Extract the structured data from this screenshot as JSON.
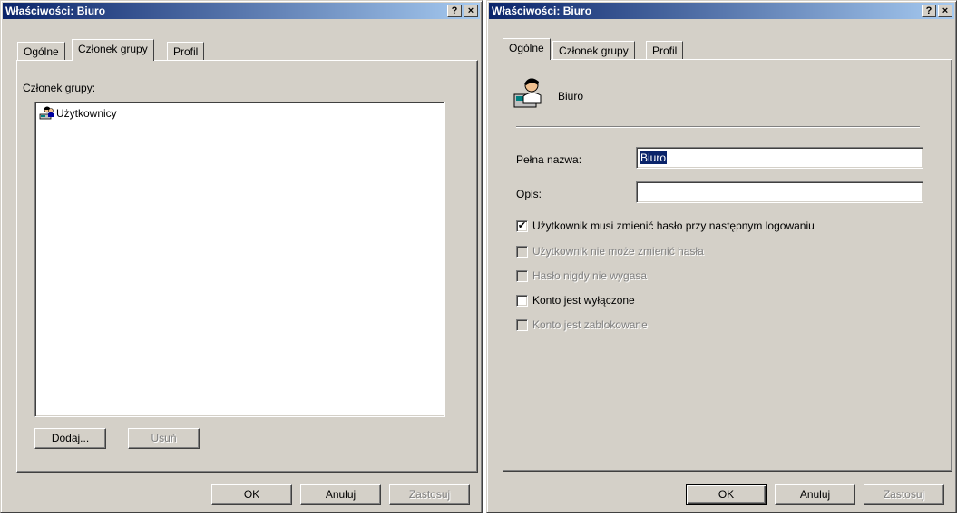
{
  "left_window": {
    "title": "Właściwości: Biuro",
    "help_button": "?",
    "close_button": "×",
    "tabs": [
      {
        "label": "Ogólne"
      },
      {
        "label": "Członek grupy"
      },
      {
        "label": "Profil"
      }
    ],
    "active_tab": "Członek grupy",
    "member_label": "Członek grupy:",
    "members": [
      {
        "name": "Użytkownicy",
        "icon": "group-icon"
      }
    ],
    "add_button": "Dodaj...",
    "remove_button": "Usuń",
    "ok_button": "OK",
    "cancel_button": "Anuluj",
    "apply_button": "Zastosuj"
  },
  "right_window": {
    "title": "Właściwości: Biuro",
    "help_button": "?",
    "close_button": "×",
    "tabs": [
      {
        "label": "Ogólne"
      },
      {
        "label": "Członek grupy"
      },
      {
        "label": "Profil"
      }
    ],
    "active_tab": "Ogólne",
    "user_icon": "user-icon",
    "user_name": "Biuro",
    "full_name_label": "Pełna nazwa:",
    "full_name_value": "Biuro",
    "description_label": "Opis:",
    "description_value": "",
    "checkboxes": [
      {
        "label": "Użytkownik musi zmienić hasło przy następnym logowaniu",
        "checked": true,
        "enabled": true
      },
      {
        "label": "Użytkownik nie może zmienić hasła",
        "checked": false,
        "enabled": false
      },
      {
        "label": "Hasło nigdy nie wygasa",
        "checked": false,
        "enabled": false
      },
      {
        "label": "Konto jest wyłączone",
        "checked": false,
        "enabled": true
      },
      {
        "label": "Konto jest zablokowane",
        "checked": false,
        "enabled": false
      }
    ],
    "ok_button": "OK",
    "cancel_button": "Anuluj",
    "apply_button": "Zastosuj"
  },
  "colors": {
    "title_start": "#0a246a",
    "title_end": "#a6caf0",
    "face": "#d4d0c8",
    "disabled_text": "#808080"
  }
}
